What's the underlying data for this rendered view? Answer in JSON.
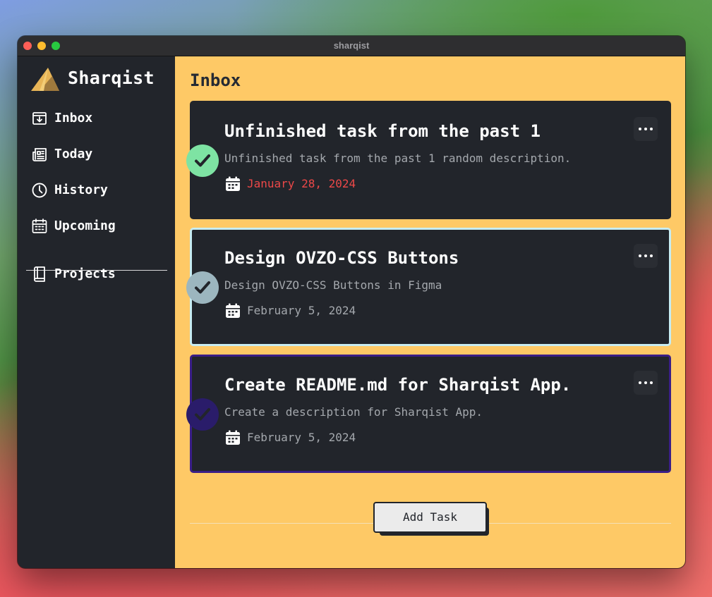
{
  "window": {
    "title": "sharqist"
  },
  "sidebar": {
    "brand": "Sharqist",
    "items": [
      {
        "label": "Inbox",
        "icon": "inbox-icon"
      },
      {
        "label": "Today",
        "icon": "newspaper-icon"
      },
      {
        "label": "History",
        "icon": "clock-icon"
      },
      {
        "label": "Upcoming",
        "icon": "calendar-icon"
      }
    ],
    "projects": {
      "label": "Projects",
      "icon": "book-icon"
    }
  },
  "main": {
    "title": "Inbox",
    "tasks": [
      {
        "title": "Unfinished task from the past 1",
        "description": "Unfinished task from the past 1 random description.",
        "date": "January 28, 2024",
        "date_color": "#ec4848",
        "check_color": "#7ee3a3",
        "border_color": "#22252b"
      },
      {
        "title": "Design OVZO-CSS Buttons",
        "description": "Design OVZO-CSS Buttons in Figma",
        "date": "February 5, 2024",
        "date_color": "#a4a8ad",
        "check_color": "#9cb6bf",
        "border_color": "#c7ecf2"
      },
      {
        "title": "Create README.md for Sharqist App.",
        "description": "Create a description for Sharqist App.",
        "date": "February 5, 2024",
        "date_color": "#a4a8ad",
        "check_color": "#2a1c6a",
        "border_color": "#3a1e86"
      }
    ],
    "add_button": "Add Task"
  },
  "colors": {
    "sidebar_bg": "#22252b",
    "main_bg": "#fec966",
    "card_bg": "#22252b"
  }
}
